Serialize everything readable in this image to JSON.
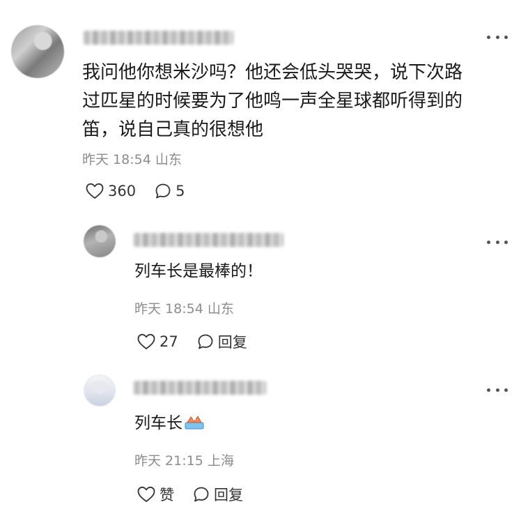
{
  "comment": {
    "lines": [
      "我问他你想米沙吗？他还会低头哭哭，说下次路",
      "过匹星的时候要为了他鸣一声全星球都听得到的",
      "笛，说自己真的很想他"
    ],
    "time": "昨天 18:54 山东",
    "likes": "360",
    "replies_count": "5"
  },
  "replies": [
    {
      "text": "列车长是最棒的！",
      "time": "昨天 18:54 山东",
      "likes": "27",
      "reply_label": "回复"
    },
    {
      "text": "列车长",
      "emoji": "cake-emoji",
      "time": "昨天 21:15 上海",
      "like_label": "赞",
      "reply_label": "回复"
    }
  ],
  "icons": {
    "like": "heart-outline-icon",
    "reply": "speech-bubble-icon",
    "more": "more-dots-icon"
  },
  "colors": {
    "text": "#1a1a1a",
    "meta": "#8c8c8c",
    "icon": "#333333",
    "background": "#ffffff"
  }
}
